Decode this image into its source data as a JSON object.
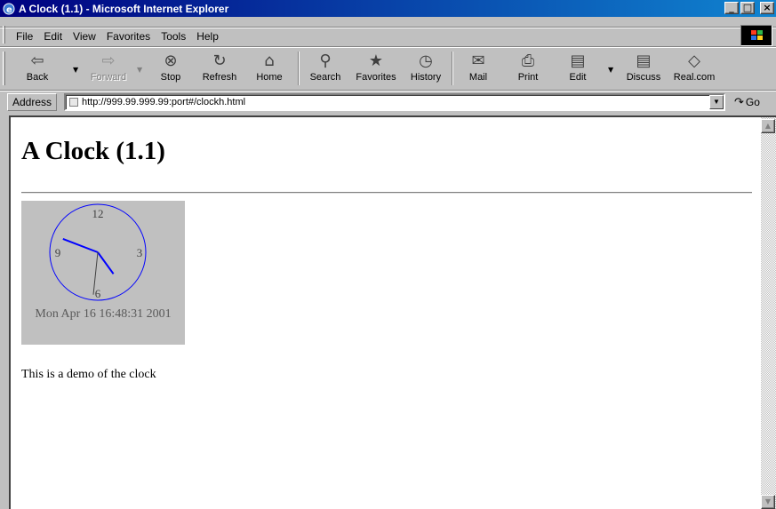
{
  "window": {
    "title": "A Clock (1.1) - Microsoft Internet Explorer",
    "controls": {
      "minimize": "_",
      "maximize": "□",
      "close": "×"
    }
  },
  "menu": [
    "File",
    "Edit",
    "View",
    "Favorites",
    "Tools",
    "Help"
  ],
  "toolbar": {
    "back": "Back",
    "forward": "Forward",
    "stop": "Stop",
    "refresh": "Refresh",
    "home": "Home",
    "search": "Search",
    "favorites": "Favorites",
    "history": "History",
    "mail": "Mail",
    "print": "Print",
    "edit": "Edit",
    "discuss": "Discuss",
    "realcom": "Real.com",
    "icons": {
      "back": "back-arrow-icon",
      "forward": "forward-arrow-icon",
      "stop": "stop-icon",
      "refresh": "refresh-icon",
      "home": "home-icon",
      "search": "search-icon",
      "favorites": "favorites-icon",
      "history": "history-icon",
      "mail": "mail-icon",
      "print": "printer-icon",
      "edit": "edit-icon",
      "discuss": "discuss-icon",
      "realcom": "realcom-icon"
    }
  },
  "address": {
    "label": "Address",
    "url": "http://999.99.999.99:port#/clockh.html",
    "go": "Go"
  },
  "page": {
    "title": "A Clock (1.1)",
    "clock": {
      "numerals": [
        "12",
        "3",
        "6",
        "9"
      ],
      "datetime": "Mon Apr 16 16:48:31 2001",
      "time": {
        "hour": 16,
        "minute": 48,
        "second": 31
      },
      "face_color": "#0000ff",
      "hands_color": "#0000ff",
      "second_hand_color": "#404040"
    },
    "body_text": "This is a demo of the clock"
  },
  "colors": {
    "titlebar_start": "#000080",
    "titlebar_end": "#1084d0",
    "chrome": "#c0c0c0"
  }
}
